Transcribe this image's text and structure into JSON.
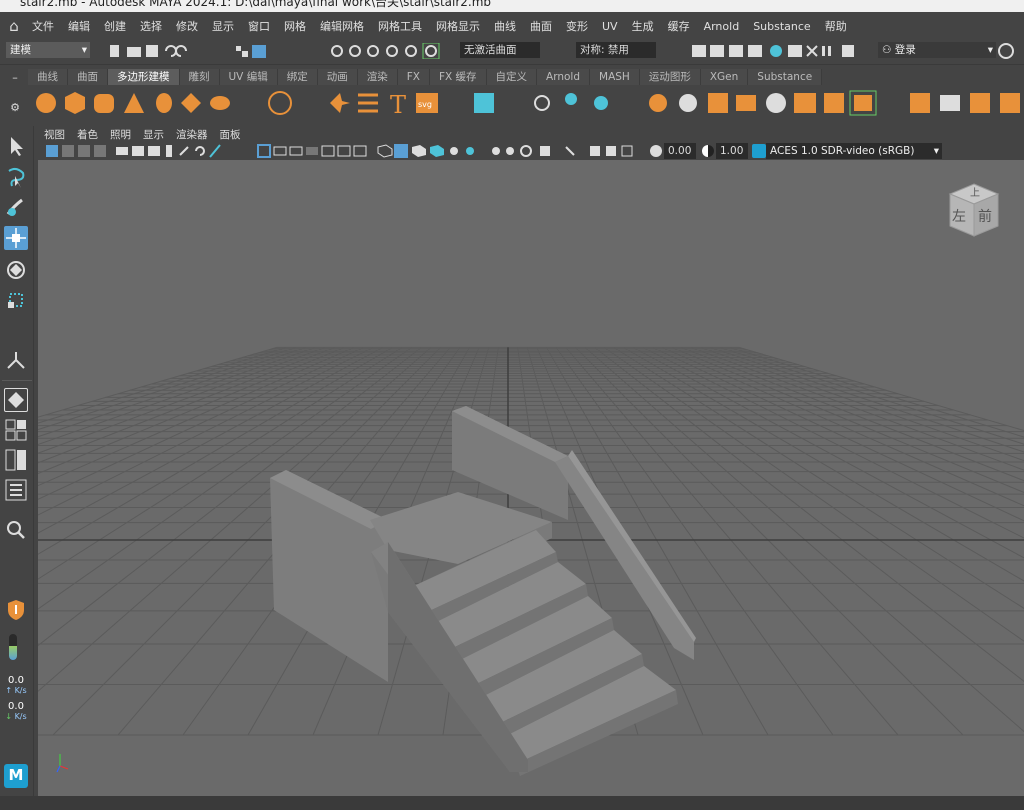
{
  "window": {
    "title": "stair2.mb - Autodesk MAYA 2024.1: D:\\dai\\maya\\final work\\台关\\stair\\stair2.mb"
  },
  "menubar": {
    "items": [
      "文件",
      "编辑",
      "创建",
      "选择",
      "修改",
      "显示",
      "窗口",
      "网格",
      "编辑网格",
      "网格工具",
      "网格显示",
      "曲线",
      "曲面",
      "变形",
      "UV",
      "生成",
      "缓存",
      "Arnold",
      "Substance",
      "帮助"
    ]
  },
  "statusline": {
    "menuset": "建模",
    "live_surface": "无激活曲面",
    "symmetry": "对称: 禁用",
    "login": "登录"
  },
  "shelf": {
    "tabs": [
      "曲线",
      "曲面",
      "多边形建模",
      "雕刻",
      "UV 编辑",
      "绑定",
      "动画",
      "渲染",
      "FX",
      "FX 缓存",
      "自定义",
      "Arnold",
      "MASH",
      "运动图形",
      "XGen",
      "Substance"
    ],
    "active_tab": "多边形建模"
  },
  "panel": {
    "menus": [
      "视图",
      "着色",
      "照明",
      "显示",
      "渲染器",
      "面板"
    ],
    "exposure": "0.00",
    "gamma": "1.00",
    "colorspace": "ACES 1.0 SDR-video (sRGB)"
  },
  "viewcube": {
    "top": "上",
    "left": "左",
    "front": "前"
  },
  "sidebar": {
    "rate_up_value": "0.0",
    "rate_up_unit": "K/s",
    "rate_down_value": "0.0",
    "rate_down_unit": "K/s",
    "maya_logo": "M"
  },
  "colors": {
    "ui_bg": "#444444",
    "viewport_bg": "#6a6a6a",
    "accent_blue": "#5a9fd4",
    "icon_orange": "#e8913a"
  }
}
